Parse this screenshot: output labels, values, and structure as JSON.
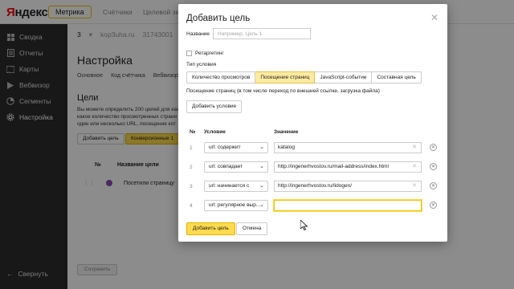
{
  "app": {
    "logo_letter": "Я",
    "logo_rest": "ндекс",
    "product": "Метрика"
  },
  "top_nav": [
    "Счётчики",
    "Целевой зво"
  ],
  "sidebar": {
    "items": [
      {
        "label": "Сводка",
        "icon": "grid-icon"
      },
      {
        "label": "Отчеты",
        "icon": "report-icon"
      },
      {
        "label": "Карты",
        "icon": "map-icon"
      },
      {
        "label": "Вебвизор",
        "icon": "play-icon"
      },
      {
        "label": "Сегменты",
        "icon": "pie-icon"
      },
      {
        "label": "Настройка",
        "icon": "gear-icon"
      }
    ],
    "active": "Настройка",
    "collapse_label": "Свернуть"
  },
  "main": {
    "counter_number": "3",
    "counter_site": "kop3uha.ru",
    "counter_id": "31743001",
    "page_title": "Настройка",
    "subtabs": [
      "Основное",
      "Код счётчика",
      "Вебвизор"
    ],
    "goals_title": "Цели",
    "goals_text": "Вы можете определить 200 целей для каж - какое количество просмотренных страни - один или несколько URL, посещение кот",
    "add_goal_button": "Добавить цель",
    "conversions_button": "Конверсионные 1",
    "table_headers": [
      "№",
      "Название цели"
    ],
    "goal_row": {
      "name": "Посетили страницу"
    },
    "save_button": "Сохранить"
  },
  "modal": {
    "title": "Добавить цель",
    "name_label": "Название",
    "name_placeholder": "Например, Цель 1",
    "retargeting_label": "Ретаргетинг",
    "condition_type_label": "Тип условия",
    "condition_types": [
      {
        "label": "Количество просмотров",
        "active": false
      },
      {
        "label": "Посещение страниц",
        "active": true
      },
      {
        "label": "JavaScript-событие",
        "active": false
      },
      {
        "label": "Составная цель",
        "active": false
      }
    ],
    "description": "Посещение страниц (в том числе переход по внешней ссылке, загрузка файла)",
    "add_condition_button": "Добавить условие",
    "col_num": "№",
    "col_condition": "Условие",
    "col_value": "Значение",
    "rows": [
      {
        "num": "1",
        "condition": "url: содержит",
        "value": "katalog"
      },
      {
        "num": "2",
        "condition": "url: совпадает",
        "value": "http://ingenerhvostov.ru/mail-address/index.html"
      },
      {
        "num": "3",
        "condition": "url: начинается с",
        "value": "http://ingenerhvostov.ru/lidogen/"
      },
      {
        "num": "4",
        "condition": "url: регулярное выр...",
        "value": ""
      }
    ],
    "submit_button": "Добавить цель",
    "cancel_button": "Отмена"
  },
  "colors": {
    "accent": "#ffdb4d",
    "sidebar_bg": "#2d2d2d",
    "brand_red": "#ff0000"
  }
}
